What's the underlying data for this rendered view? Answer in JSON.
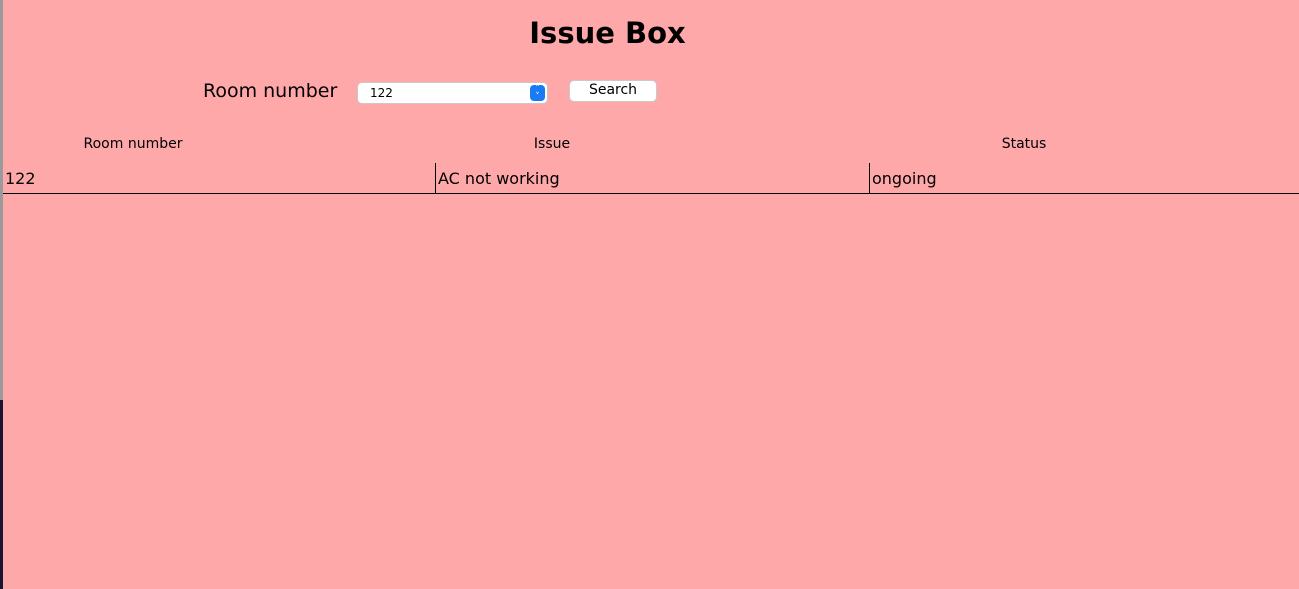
{
  "title": "Issue Box",
  "search": {
    "label": "Room number",
    "selected_room": "122",
    "button_label": "Search"
  },
  "table": {
    "headers": [
      "Room number",
      "Issue",
      "Status"
    ],
    "rows": [
      {
        "room": "122",
        "issue": "AC not working",
        "status": "ongoing"
      }
    ]
  },
  "colors": {
    "background": "#ffa8a9",
    "select_arrow": "#1a7cf5"
  }
}
